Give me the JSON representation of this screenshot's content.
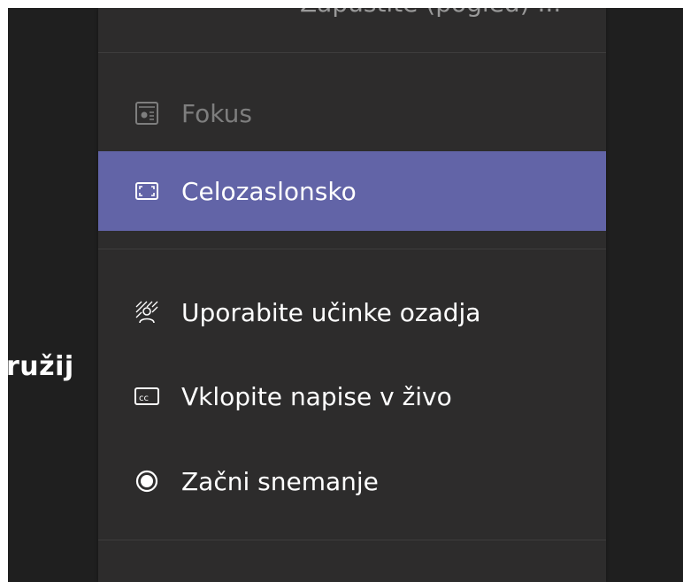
{
  "background": {
    "partial_text": "ružij"
  },
  "menu": {
    "top_partial_label": "Zapustite (pogled) ...",
    "items": [
      {
        "label": "Fokus",
        "icon": "focus-icon",
        "state": "disabled"
      },
      {
        "label": "Celozaslonsko",
        "icon": "fullscreen-icon",
        "state": "selected"
      },
      {
        "label": "Uporabite učinke ozadja",
        "icon": "background-effects-icon",
        "state": "normal"
      },
      {
        "label": "Vklopite napise v živo",
        "icon": "captions-icon",
        "state": "normal"
      },
      {
        "label": "Začni snemanje",
        "icon": "record-icon",
        "state": "normal"
      }
    ]
  },
  "colors": {
    "menu_background": "#2d2c2c",
    "selected_background": "#6264a7",
    "text": "#ffffff",
    "disabled_text": "#7e7e7e",
    "stage_background": "#1f1f1f"
  }
}
